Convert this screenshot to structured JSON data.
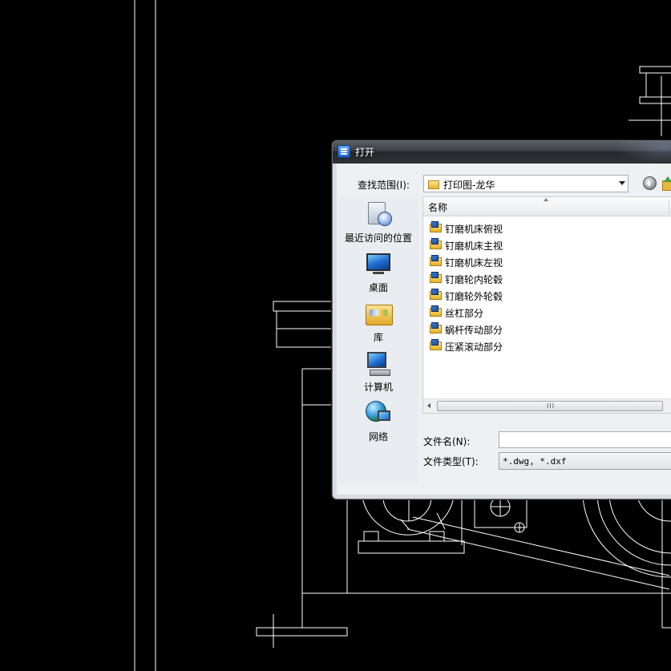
{
  "dialog": {
    "title": "打开",
    "look_in_label": "查找范围(I):",
    "look_in_value": "打印图-龙华",
    "places": [
      {
        "label": "最近访问的位置"
      },
      {
        "label": "桌面"
      },
      {
        "label": "库"
      },
      {
        "label": "计算机"
      },
      {
        "label": "网络"
      }
    ],
    "columns": {
      "name": "名称"
    },
    "files": [
      {
        "name": "钉磨机床俯视"
      },
      {
        "name": "钉磨机床主视"
      },
      {
        "name": "钉磨机床左视"
      },
      {
        "name": "钉磨轮内轮毂"
      },
      {
        "name": "钉磨轮外轮毂"
      },
      {
        "name": "丝杠部分"
      },
      {
        "name": "蜗杆传动部分"
      },
      {
        "name": "压紧滚动部分"
      }
    ],
    "scroll_grip": "III",
    "file_name_label": "文件名(N):",
    "file_name_value": "",
    "file_type_label": "文件类型(T):",
    "file_type_value": "*.dwg, *.dxf"
  },
  "colors": {
    "cad_background": "#000000",
    "cad_lines": "#ffffff"
  }
}
